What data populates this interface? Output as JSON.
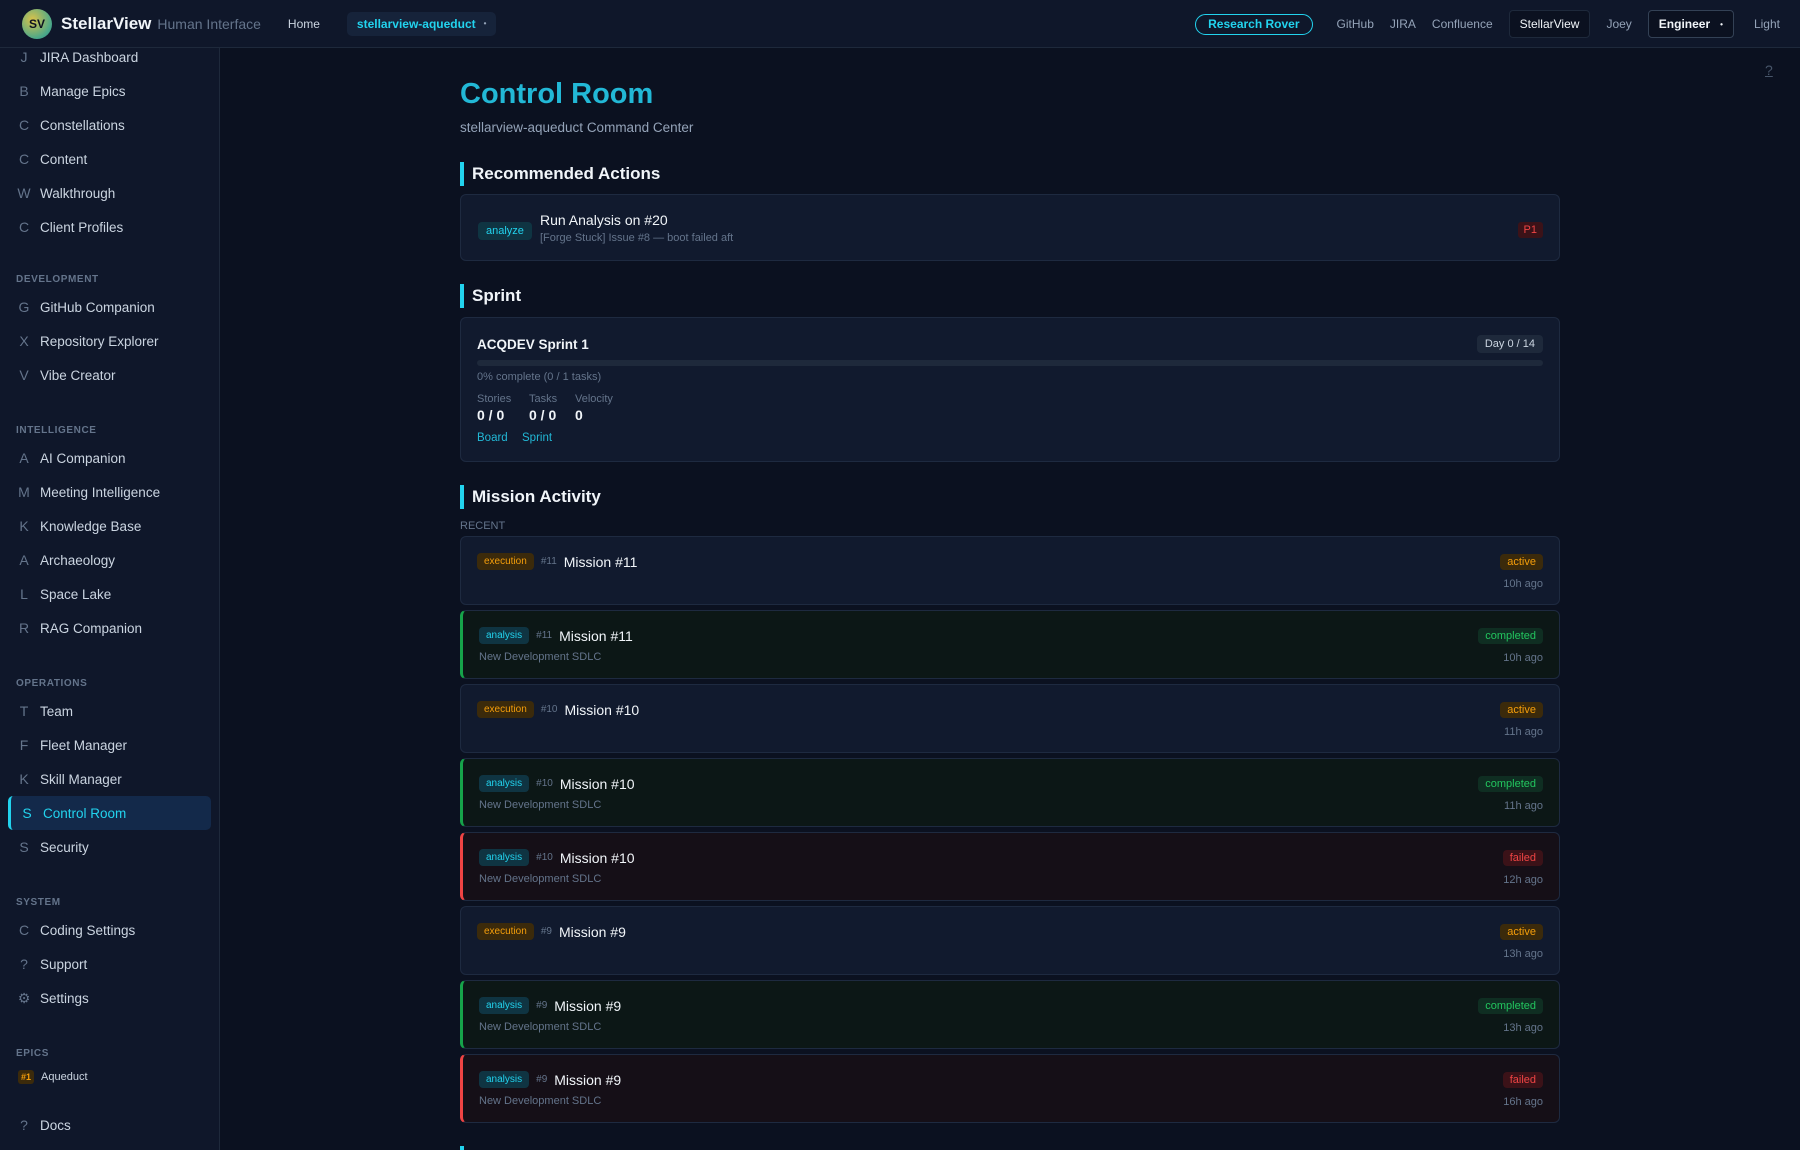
{
  "header": {
    "logo_initials": "SV",
    "brand": "StellarView",
    "brand_sub": "Human Interface",
    "home": "Home",
    "project": "stellarview-aqueduct",
    "research_rover": "Research Rover",
    "links": [
      "GitHub",
      "JIRA",
      "Confluence",
      "StellarView",
      "Joey"
    ],
    "role": "Engineer",
    "theme": "Light"
  },
  "sidebar": {
    "top_items": [
      {
        "letter": "J",
        "label": "JIRA Dashboard"
      },
      {
        "letter": "B",
        "label": "Manage Epics"
      },
      {
        "letter": "C",
        "label": "Constellations"
      },
      {
        "letter": "C",
        "label": "Content"
      },
      {
        "letter": "W",
        "label": "Walkthrough"
      },
      {
        "letter": "C",
        "label": "Client Profiles"
      }
    ],
    "development_title": "DEVELOPMENT",
    "development": [
      {
        "letter": "G",
        "label": "GitHub Companion"
      },
      {
        "letter": "X",
        "label": "Repository Explorer"
      },
      {
        "letter": "V",
        "label": "Vibe Creator"
      }
    ],
    "intelligence_title": "INTELLIGENCE",
    "intelligence": [
      {
        "letter": "A",
        "label": "AI Companion"
      },
      {
        "letter": "M",
        "label": "Meeting Intelligence"
      },
      {
        "letter": "K",
        "label": "Knowledge Base"
      },
      {
        "letter": "A",
        "label": "Archaeology"
      },
      {
        "letter": "L",
        "label": "Space Lake"
      },
      {
        "letter": "R",
        "label": "RAG Companion"
      }
    ],
    "operations_title": "OPERATIONS",
    "operations": [
      {
        "letter": "T",
        "label": "Team"
      },
      {
        "letter": "F",
        "label": "Fleet Manager"
      },
      {
        "letter": "K",
        "label": "Skill Manager"
      },
      {
        "letter": "S",
        "label": "Control Room"
      },
      {
        "letter": "S",
        "label": "Security"
      }
    ],
    "system_title": "SYSTEM",
    "system": [
      {
        "letter": "C",
        "label": "Coding Settings"
      },
      {
        "letter": "?",
        "label": "Support"
      },
      {
        "letter": "⚙",
        "label": "Settings"
      }
    ],
    "epics_title": "EPICS",
    "epic_badge": "#1",
    "epic_label": "Aqueduct",
    "docs_letter": "?",
    "docs_label": "Docs"
  },
  "main": {
    "help": "?",
    "title": "Control Room",
    "subtitle": "stellarview-aqueduct Command Center",
    "recommended_title": "Recommended Actions",
    "recommended": {
      "tag": "analyze",
      "title": "Run Analysis on #20",
      "subtitle": "[Forge Stuck] Issue #8 — boot failed aft",
      "priority": "P1"
    },
    "sprint_title": "Sprint",
    "sprint": {
      "name": "ACQDEV Sprint 1",
      "day": "Day 0 / 14",
      "progress": 0,
      "progress_text": "0% complete (0 / 1 tasks)",
      "stats": [
        {
          "label": "Stories",
          "value": "0 / 0"
        },
        {
          "label": "Tasks",
          "value": "0 / 0"
        },
        {
          "label": "Velocity",
          "value": "0"
        }
      ],
      "link_board": "Board",
      "link_sprint": "Sprint"
    },
    "activity_title": "Mission Activity",
    "recent_label": "RECENT",
    "missions": [
      {
        "type": "execution",
        "num": "#11",
        "title": "Mission #11",
        "sub": "",
        "status": "active",
        "time": "10h ago"
      },
      {
        "type": "analysis",
        "num": "#11",
        "title": "Mission #11",
        "sub": "New Development SDLC",
        "status": "completed",
        "time": "10h ago"
      },
      {
        "type": "execution",
        "num": "#10",
        "title": "Mission #10",
        "sub": "",
        "status": "active",
        "time": "11h ago"
      },
      {
        "type": "analysis",
        "num": "#10",
        "title": "Mission #10",
        "sub": "New Development SDLC",
        "status": "completed",
        "time": "11h ago"
      },
      {
        "type": "analysis",
        "num": "#10",
        "title": "Mission #10",
        "sub": "New Development SDLC",
        "status": "failed",
        "time": "12h ago"
      },
      {
        "type": "execution",
        "num": "#9",
        "title": "Mission #9",
        "sub": "",
        "status": "active",
        "time": "13h ago"
      },
      {
        "type": "analysis",
        "num": "#9",
        "title": "Mission #9",
        "sub": "New Development SDLC",
        "status": "completed",
        "time": "13h ago"
      },
      {
        "type": "analysis",
        "num": "#9",
        "title": "Mission #9",
        "sub": "New Development SDLC",
        "status": "failed",
        "time": "16h ago"
      }
    ]
  }
}
